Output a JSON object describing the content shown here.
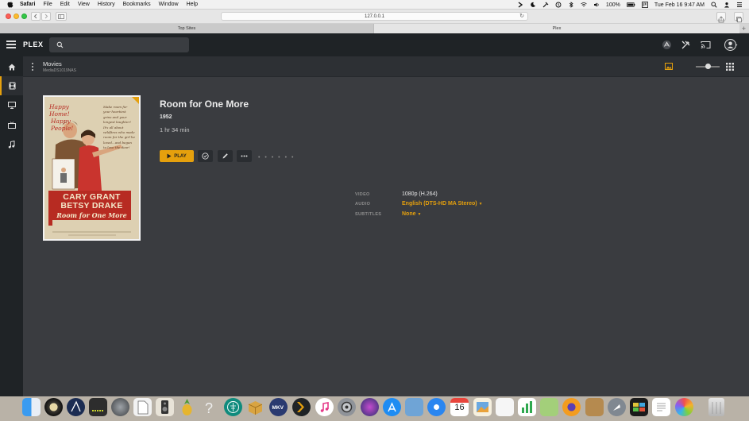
{
  "menubar": {
    "app_name": "Safari",
    "menus": [
      "File",
      "Edit",
      "View",
      "History",
      "Bookmarks",
      "Window",
      "Help"
    ],
    "battery": "100%",
    "datetime": "Tue Feb 16  9:47 AM"
  },
  "browser": {
    "address": "127.0.0.1",
    "tabs": [
      {
        "label": "Top Sites"
      },
      {
        "label": "Plex"
      }
    ]
  },
  "plex": {
    "logo": "PLEX",
    "search_placeholder": ""
  },
  "library": {
    "title": "Movies",
    "server": "MediaDS1019NAS"
  },
  "movie": {
    "title": "Room for One More",
    "year": "1952",
    "duration": "1 hr 34 min",
    "play_label": "PLAY",
    "more_dots": "• • • • • •",
    "poster_text": {
      "tagline_1": "Happy Home!",
      "tagline_2": "Happy People!",
      "blurb": "Make room for your heartiest grins and your longest laughter! It's all about wildfires who made room for the girl he loved...and began to love the dear!",
      "star_1": "CARY GRANT",
      "star_2": "BETSY DRAKE",
      "film_title": "Room for One More"
    },
    "media": [
      {
        "label": "VIDEO",
        "value": "1080p (H.264)",
        "dropdown": false
      },
      {
        "label": "AUDIO",
        "value": "English (DTS-HD MA Stereo)",
        "dropdown": true
      },
      {
        "label": "SUBTITLES",
        "value": "None",
        "dropdown": true
      }
    ]
  },
  "colors": {
    "accent": "#e5a00d",
    "plex_dark": "#1f2326",
    "content_bg": "#3a3c40"
  },
  "dock": {
    "apps": [
      "finder-icon",
      "disk-icon",
      "affinity-icon",
      "music-bars-icon",
      "safari-like-icon",
      "file-icon",
      "speaker-icon",
      "pineapple-icon",
      "help-icon",
      "tree-icon",
      "box-icon",
      "mkv-icon",
      "plex-icon",
      "itunes-icon",
      "settings-icon",
      "siri-icon",
      "appstore-icon",
      "preview-icon",
      "safari-icon",
      "calendar-icon",
      "photos-icon",
      "numbers-icon",
      "maps-icon",
      "firefox-icon",
      "notes-icon",
      "launchpad-icon",
      "activity-icon",
      "textedit-icon",
      "photos-app-icon",
      "trash-icon"
    ],
    "calendar_day": "16"
  }
}
